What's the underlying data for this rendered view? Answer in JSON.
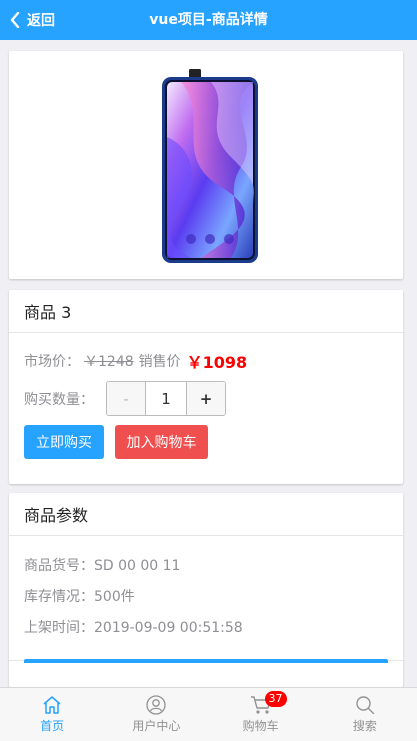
{
  "header": {
    "back_label": "返回",
    "title": "vue项目-商品详情",
    "color": "#26a2ff"
  },
  "product": {
    "title": "商品 3",
    "market_price_label": "市场价：",
    "market_price": "￥1248",
    "sale_price_label": "销售价",
    "sale_price": "￥1098",
    "quantity_label": "购买数量：",
    "quantity": "1",
    "minus_label": "-",
    "plus_label": "+",
    "buy_button": "立即购买",
    "cart_button": "加入购物车"
  },
  "params": {
    "title": "商品参数",
    "rows": [
      {
        "text": "商品货号：SD 00 00 11"
      },
      {
        "text": "库存情况：500件"
      },
      {
        "text": "上架时间：2019-09-09 00:51:58"
      }
    ]
  },
  "tabbar": {
    "items": [
      {
        "label": "首页",
        "icon": "home-icon",
        "active": true
      },
      {
        "label": "用户中心",
        "icon": "user-icon",
        "active": false
      },
      {
        "label": "购物车",
        "icon": "cart-icon",
        "active": false,
        "badge": "37"
      },
      {
        "label": "搜索",
        "icon": "search-icon",
        "active": false
      }
    ]
  },
  "colors": {
    "accent": "#26a2ff",
    "danger": "#ef4f4f",
    "price": "#ff0000"
  }
}
